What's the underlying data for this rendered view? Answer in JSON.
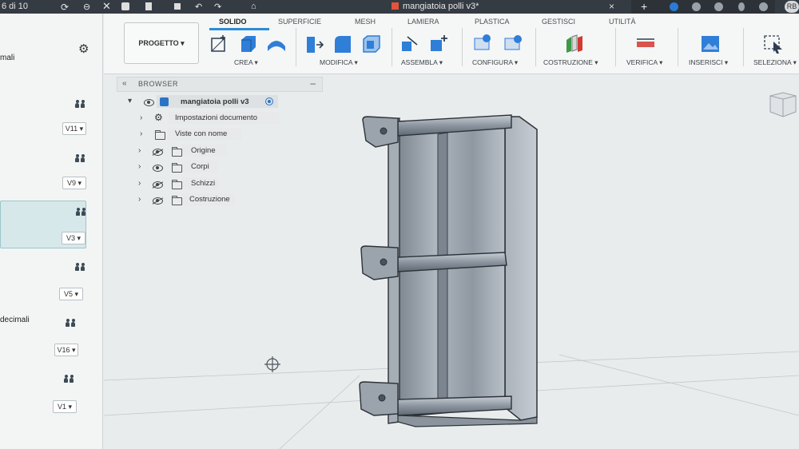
{
  "titlebar": {
    "page_counter": "6 di 10",
    "doc_title": "mangiatoia polli v3*",
    "close_symbol": "×",
    "plus_symbol": "+",
    "avatar_initials": "RB"
  },
  "left_panel": {
    "partial_labels": [
      "mali",
      "decimali"
    ],
    "versions": [
      "V11",
      "V9",
      "V3",
      "V5",
      "V16",
      "V1"
    ],
    "selected_index": 2
  },
  "toolbar": {
    "project_button": "PROGETTO",
    "tabs": [
      "SOLIDO",
      "SUPERFICIE",
      "MESH",
      "LAMIERA",
      "PLASTICA",
      "GESTISCI",
      "UTILITÀ"
    ],
    "active_tab": "SOLIDO",
    "groups": [
      "CREA",
      "MODIFICA",
      "ASSEMBLA",
      "CONFIGURA",
      "COSTRUZIONE",
      "VERIFICA",
      "INSERISCI",
      "SELEZIONA"
    ]
  },
  "browser": {
    "title": "BROWSER",
    "collapse_symbol": "«",
    "minimize_symbol": "–",
    "root": "mangiatoia polli v3",
    "items": [
      {
        "label": "Impostazioni documento",
        "icon": "gear-icon"
      },
      {
        "label": "Viste con nome",
        "icon": "folder-icon"
      },
      {
        "label": "Origine",
        "icon": "folder-icon",
        "visible": false
      },
      {
        "label": "Corpi",
        "icon": "folder-icon",
        "visible": true
      },
      {
        "label": "Schizzi",
        "icon": "folder-icon",
        "visible": false
      },
      {
        "label": "Costruzione",
        "icon": "folder-icon",
        "visible": false
      }
    ]
  },
  "colors": {
    "titlebar": "#343b43",
    "accent": "#2b8cd6",
    "body_fill": "#9aa4ae",
    "body_edge": "#2c3137"
  }
}
